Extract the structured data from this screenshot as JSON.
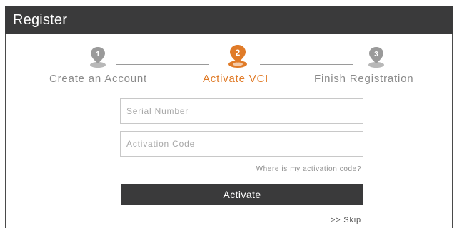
{
  "window": {
    "title": "Register"
  },
  "colors": {
    "accent": "#e07b28",
    "inactive": "#9a9a9a",
    "dark": "#3a3a3b"
  },
  "steps": [
    {
      "number": "1",
      "label": "Create an Account",
      "state": "inactive",
      "icon": "map-pin-icon"
    },
    {
      "number": "2",
      "label": "Activate VCI",
      "state": "active",
      "icon": "map-pin-icon"
    },
    {
      "number": "3",
      "label": "Finish Registration",
      "state": "inactive",
      "icon": "map-pin-icon"
    }
  ],
  "form": {
    "serial_placeholder": "Serial Number",
    "serial_value": "",
    "activation_placeholder": "Activation Code",
    "activation_value": "",
    "help_link": "Where is my activation code?",
    "activate_label": "Activate",
    "skip_label": ">> Skip"
  }
}
